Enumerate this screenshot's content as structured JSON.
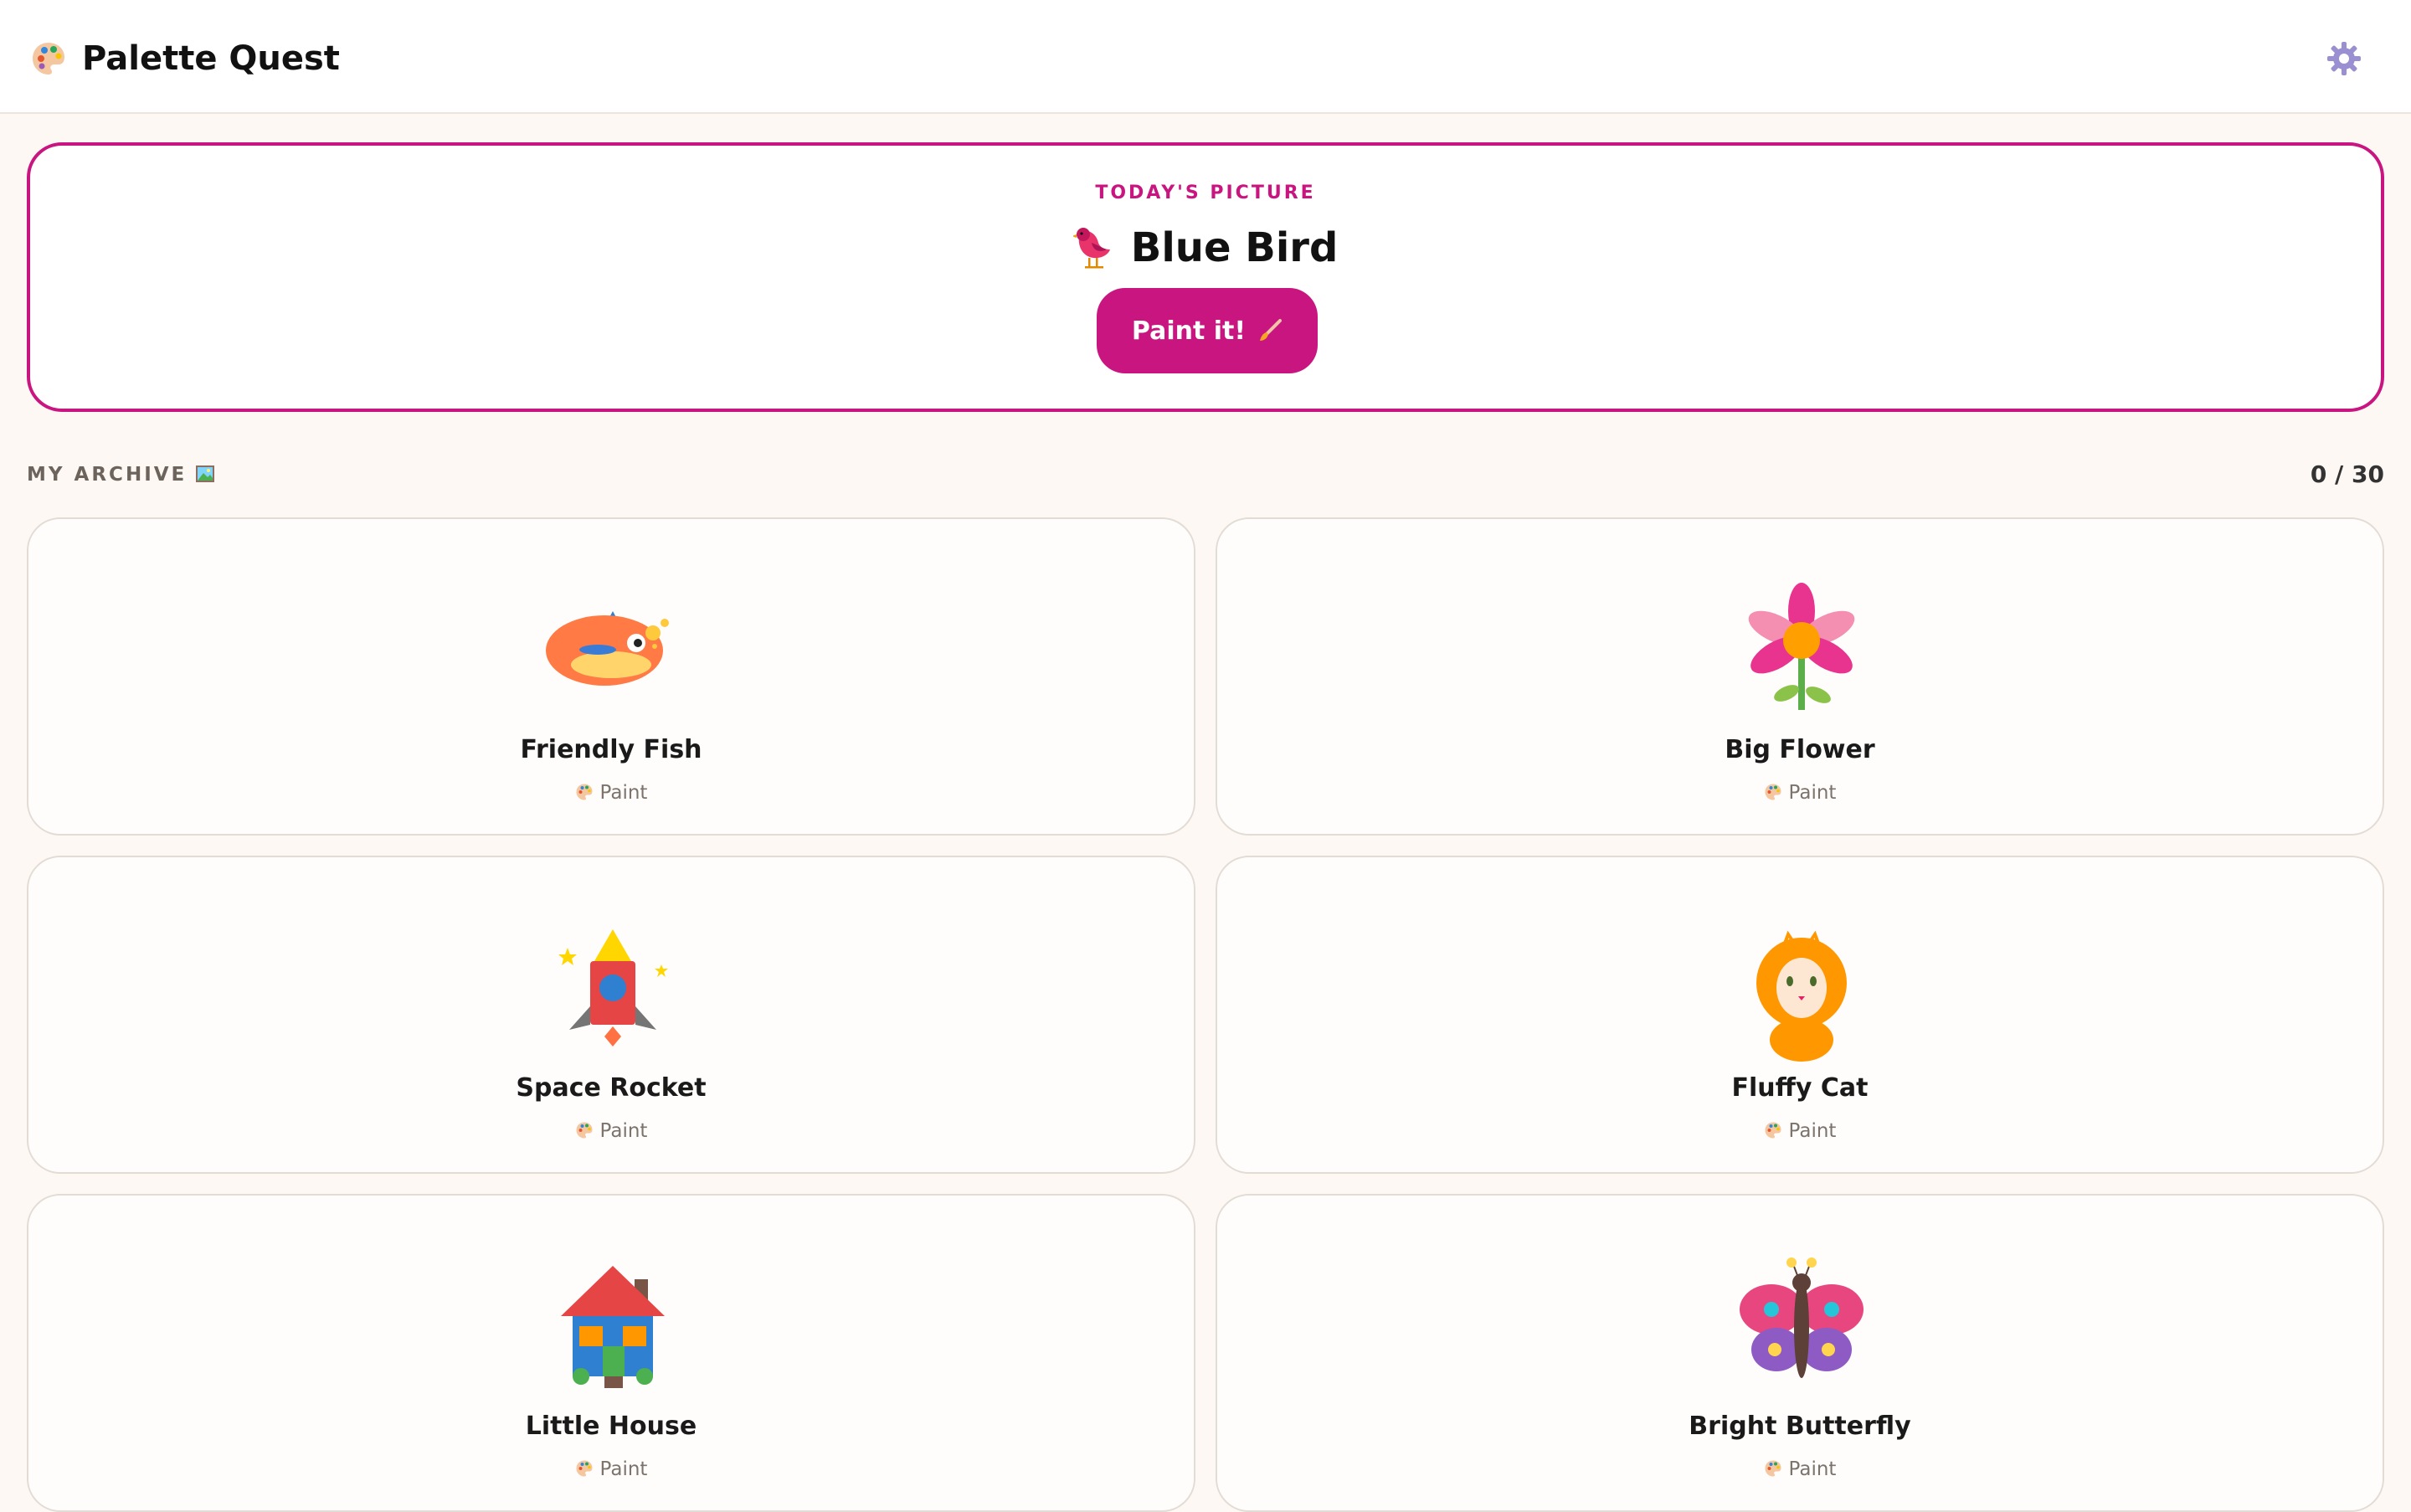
{
  "app": {
    "title": "Palette Quest",
    "logo_icon": "palette-icon",
    "settings_icon": "gear-icon"
  },
  "hero": {
    "eyebrow": "TODAY'S PICTURE",
    "title": "Blue Bird",
    "title_icon": "bird-icon",
    "button_label": "Paint it!",
    "button_icon": "paintbrush-icon"
  },
  "archive": {
    "label": "MY ARCHIVE",
    "label_icon": "framed-picture-icon",
    "count": "0 / 30",
    "items": [
      {
        "name": "Friendly Fish",
        "action": "Paint",
        "art": "fish"
      },
      {
        "name": "Big Flower",
        "action": "Paint",
        "art": "flower"
      },
      {
        "name": "Space Rocket",
        "action": "Paint",
        "art": "rocket"
      },
      {
        "name": "Fluffy Cat",
        "action": "Paint",
        "art": "cat"
      },
      {
        "name": "Little House",
        "action": "Paint",
        "art": "house"
      },
      {
        "name": "Bright Butterfly",
        "action": "Paint",
        "art": "butterfly"
      }
    ]
  },
  "colors": {
    "accent": "#c8157f",
    "background": "#fdf8f3",
    "card_border": "#e3dcd5"
  }
}
